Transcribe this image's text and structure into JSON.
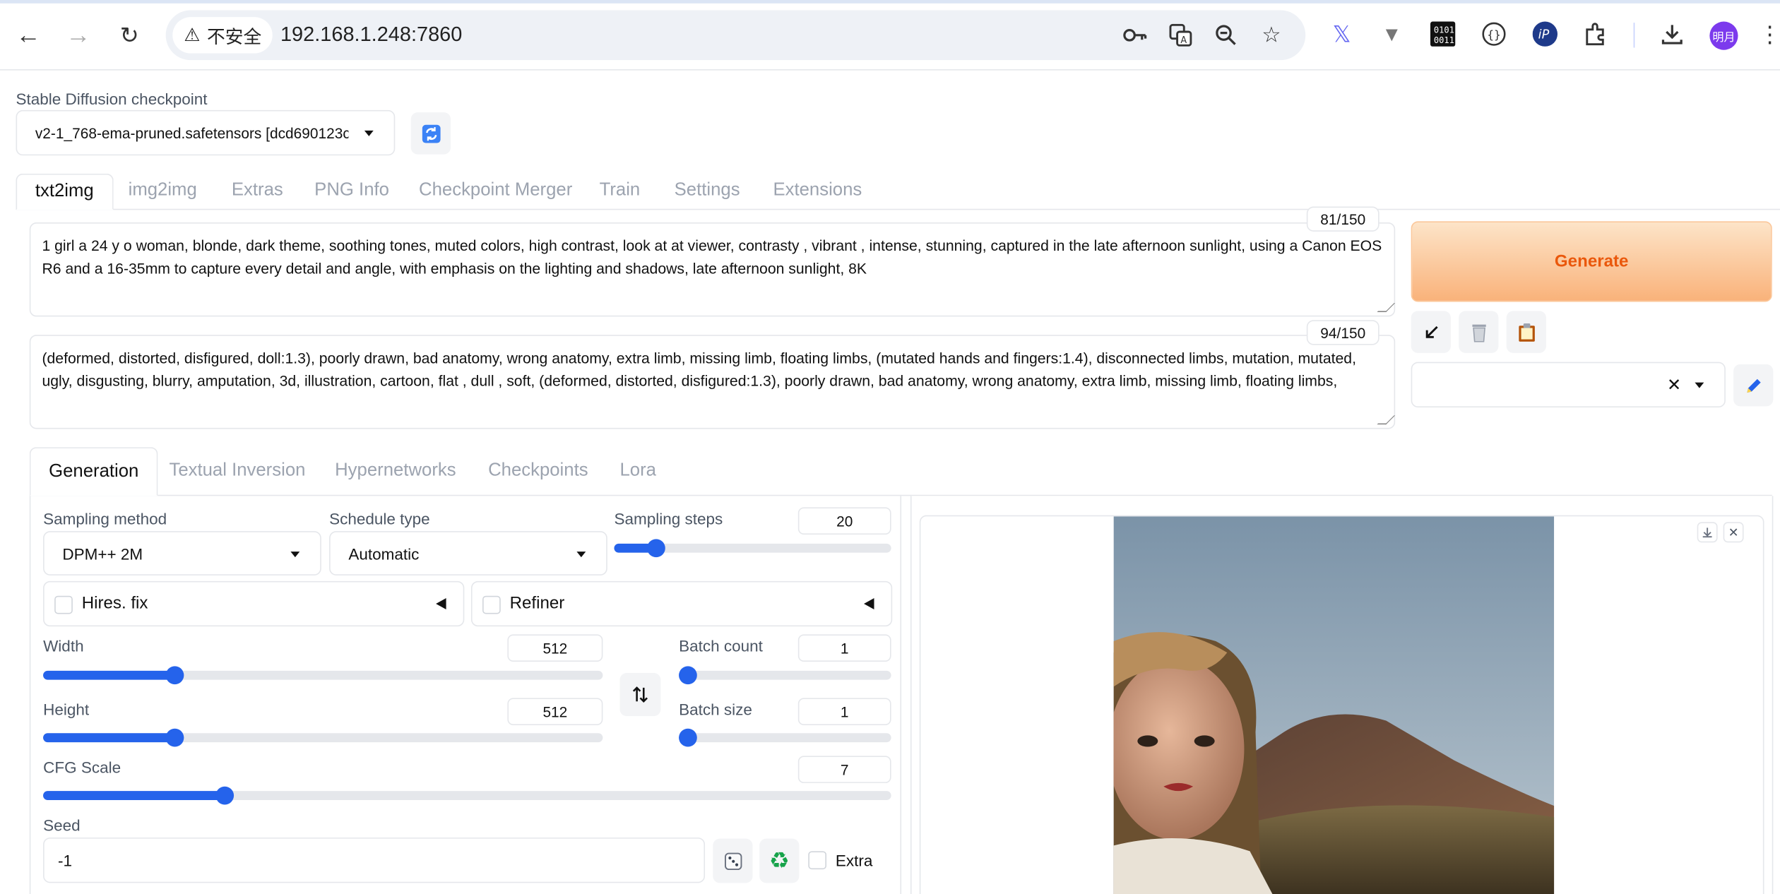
{
  "browser": {
    "security_label": "不安全",
    "url": "192.168.1.248:7860",
    "profile_initials": "明月"
  },
  "checkpoint": {
    "label": "Stable Diffusion checkpoint",
    "value": "v2-1_768-ema-pruned.safetensors [dcd690123c"
  },
  "main_tabs": [
    "txt2img",
    "img2img",
    "Extras",
    "PNG Info",
    "Checkpoint Merger",
    "Train",
    "Settings",
    "Extensions"
  ],
  "prompt": {
    "text": "1 girl a 24 y o woman, blonde, dark theme, soothing tones, muted colors, high contrast, look at at viewer, contrasty , vibrant , intense, stunning, captured in the late afternoon sunlight, using a Canon EOS R6 and a 16-35mm to capture every detail and angle, with emphasis on the lighting and shadows, late afternoon sunlight, 8K",
    "counter": "81/150"
  },
  "negative_prompt": {
    "text": "(deformed, distorted, disfigured, doll:1.3), poorly drawn, bad anatomy, wrong anatomy, extra limb, missing limb, floating limbs, (mutated hands and fingers:1.4), disconnected limbs, mutation, mutated, ugly, disgusting, blurry, amputation, 3d, illustration, cartoon, flat , dull , soft, (deformed, distorted, disfigured:1.3), poorly drawn, bad anatomy, wrong anatomy, extra limb, missing limb, floating limbs,",
    "counter": "94/150"
  },
  "generate_label": "Generate",
  "sub_tabs": [
    "Generation",
    "Textual Inversion",
    "Hypernetworks",
    "Checkpoints",
    "Lora"
  ],
  "generation": {
    "sampling_method_label": "Sampling method",
    "sampling_method": "DPM++ 2M",
    "schedule_type_label": "Schedule type",
    "schedule_type": "Automatic",
    "sampling_steps_label": "Sampling steps",
    "sampling_steps": "20",
    "sampling_steps_fraction": 0.1515,
    "hires_label": "Hires. fix",
    "refiner_label": "Refiner",
    "width_label": "Width",
    "width": "512",
    "width_fraction": 0.2353,
    "height_label": "Height",
    "height": "512",
    "height_fraction": 0.2353,
    "batch_count_label": "Batch count",
    "batch_count": "1",
    "batch_count_fraction": 0,
    "batch_size_label": "Batch size",
    "batch_size": "1",
    "batch_size_fraction": 0,
    "cfg_label": "CFG Scale",
    "cfg": "7",
    "cfg_fraction": 0.2137,
    "seed_label": "Seed",
    "seed": "-1",
    "extra_label": "Extra"
  },
  "colors": {
    "accent": "#2563eb",
    "generate_from": "#fdd9b5",
    "generate_to": "#f9b27a",
    "generate_text": "#ea580c"
  }
}
